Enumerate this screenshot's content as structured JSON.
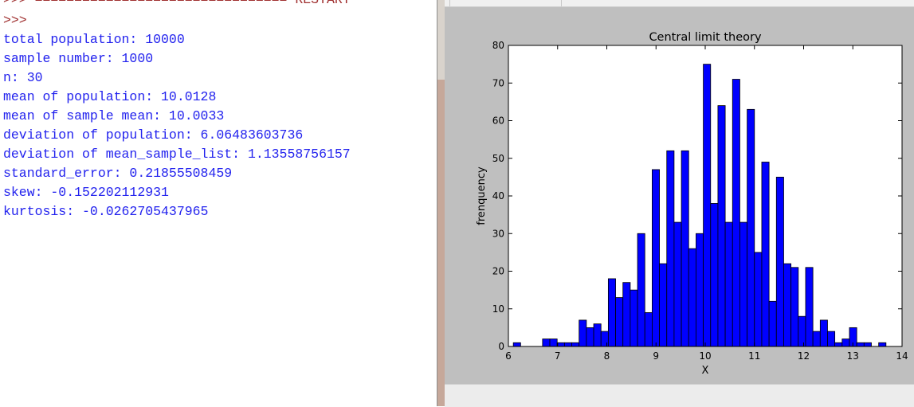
{
  "shell": {
    "prompt_restart": ">>> ================================ RESTART",
    "prompt_empty": ">>>",
    "lines": [
      "total population: 10000",
      "sample number: 1000",
      "n: 30",
      "mean of population: 10.0128",
      "mean of sample mean: 10.0033",
      "deviation of population: 6.06483603736",
      "deviation of mean_sample_list: 1.13558756157",
      "standard_error: 0.21855508459",
      "skew: -0.152202112931",
      "kurtosis: -0.0262705437965"
    ]
  },
  "colors": {
    "prompt": "#a03030",
    "output": "#2222ee",
    "bar_fill": "#0000ff",
    "plot_bg": "#bfbfbf"
  },
  "chart_data": {
    "type": "bar",
    "title": "Central limit theory",
    "xlabel": "X",
    "ylabel": "frenquency",
    "xlim": [
      6,
      14
    ],
    "ylim": [
      0,
      80
    ],
    "x_ticks": [
      6,
      7,
      8,
      9,
      10,
      11,
      12,
      13,
      14
    ],
    "y_ticks": [
      0,
      10,
      20,
      30,
      40,
      50,
      60,
      70,
      80
    ],
    "grid": false,
    "bin_start": 6.1,
    "bin_width": 0.1485,
    "values": [
      1,
      0,
      0,
      0,
      2,
      2,
      1,
      1,
      1,
      7,
      5,
      6,
      4,
      18,
      13,
      17,
      15,
      30,
      9,
      47,
      22,
      52,
      33,
      52,
      26,
      30,
      75,
      38,
      64,
      33,
      71,
      33,
      63,
      25,
      49,
      12,
      45,
      22,
      21,
      8,
      21,
      4,
      7,
      4,
      1,
      2,
      5,
      1,
      1,
      0,
      1
    ]
  }
}
